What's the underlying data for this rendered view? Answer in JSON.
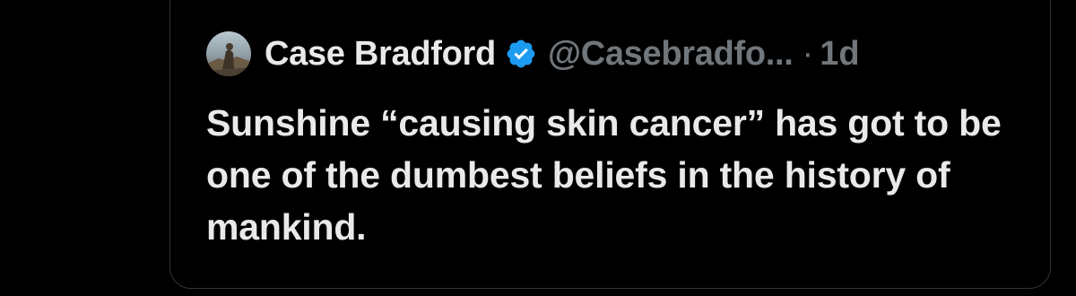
{
  "tweet": {
    "author": {
      "display_name": "Case Bradford",
      "handle": "@Casebradfo...",
      "verified": true,
      "avatar_icon": "profile-photo"
    },
    "separator": "·",
    "time": "1d",
    "text": "Sunshine “causing skin cancer” has got to be one of the dumbest beliefs in the history of mankind."
  },
  "colors": {
    "background": "#000000",
    "border": "#2f3336",
    "primary_text": "#e7e9ea",
    "secondary_text": "#71767b",
    "verified_badge": "#1d9bf0"
  }
}
